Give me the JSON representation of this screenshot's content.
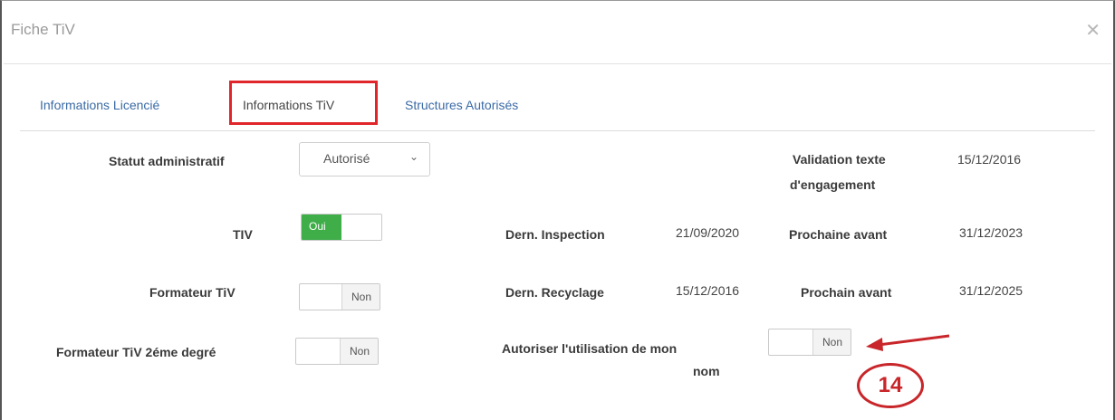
{
  "modal": {
    "title": "Fiche TiV",
    "close_icon": "close-icon"
  },
  "tabs": [
    {
      "label": "Informations Licencié"
    },
    {
      "label": "Informations TiV",
      "active": true
    },
    {
      "label": "Structures Autorisés"
    }
  ],
  "fields": {
    "statut_administratif": {
      "label": "Statut administratif",
      "value": "Autorisé"
    },
    "tiv": {
      "label": "TIV",
      "toggle_on": "Oui"
    },
    "formateur_tiv": {
      "label": "Formateur TiV",
      "toggle_off": "Non"
    },
    "formateur_tiv_2": {
      "label": "Formateur TiV 2éme degré",
      "toggle_off": "Non"
    },
    "validation": {
      "label_line1": "Validation texte",
      "label_line2": "d'engagement",
      "value": "15/12/2016"
    },
    "dern_inspection": {
      "label": "Dern. Inspection",
      "value": "21/09/2020"
    },
    "prochaine_avant": {
      "label": "Prochaine avant",
      "value": "31/12/2023"
    },
    "dern_recyclage": {
      "label": "Dern. Recyclage",
      "value": "15/12/2016"
    },
    "prochain_avant": {
      "label": "Prochain avant",
      "value": "31/12/2025"
    },
    "autoriser": {
      "label_line1": "Autoriser l'utilisation de mon",
      "label_line2": "nom",
      "toggle_off": "Non"
    }
  },
  "annotation": {
    "number": "14",
    "color": "#c8262a"
  },
  "colors": {
    "toggle_on": "#3fae49",
    "highlight": "#e0262a",
    "link": "#3a6aa5"
  }
}
